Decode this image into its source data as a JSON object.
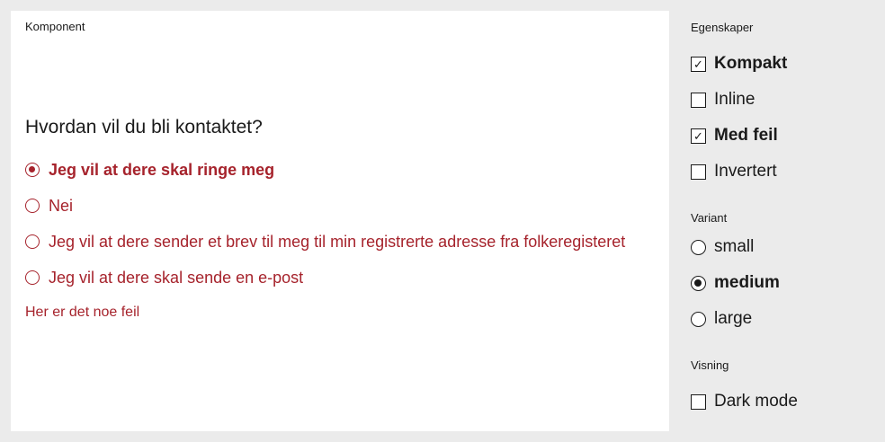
{
  "component_panel": {
    "title": "Komponent",
    "legend": "Hvordan vil du bli kontaktet?",
    "options": [
      {
        "label": "Jeg vil at dere skal ringe meg",
        "checked": true
      },
      {
        "label": "Nei",
        "checked": false
      },
      {
        "label": "Jeg vil at dere sender et brev til meg til min registrerte adresse fra folkeregisteret",
        "checked": false
      },
      {
        "label": "Jeg vil at dere skal sende en e-post",
        "checked": false
      }
    ],
    "error_message": "Her er det noe feil",
    "error_color": "#a6232c"
  },
  "properties": {
    "heading": "Egenskaper",
    "items": [
      {
        "label": "Kompakt",
        "checked": true,
        "check_mark": "✓"
      },
      {
        "label": "Inline",
        "checked": false,
        "check_mark": ""
      },
      {
        "label": "Med feil",
        "checked": true,
        "check_mark": "✓"
      },
      {
        "label": "Invertert",
        "checked": false,
        "check_mark": ""
      }
    ]
  },
  "variant": {
    "heading": "Variant",
    "items": [
      {
        "label": "small",
        "checked": false
      },
      {
        "label": "medium",
        "checked": true
      },
      {
        "label": "large",
        "checked": false
      }
    ]
  },
  "display": {
    "heading": "Visning",
    "items": [
      {
        "label": "Dark mode",
        "checked": false,
        "check_mark": ""
      }
    ]
  }
}
